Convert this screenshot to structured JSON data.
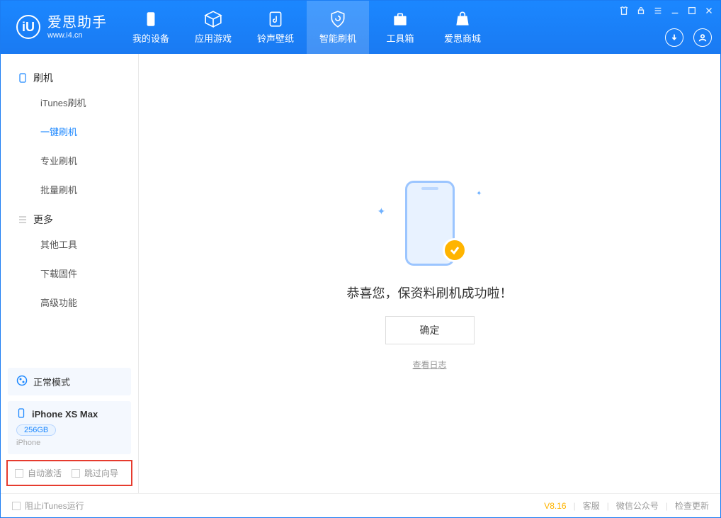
{
  "app": {
    "name": "爱思助手",
    "url": "www.i4.cn"
  },
  "tabs": [
    {
      "label": "我的设备"
    },
    {
      "label": "应用游戏"
    },
    {
      "label": "铃声壁纸"
    },
    {
      "label": "智能刷机"
    },
    {
      "label": "工具箱"
    },
    {
      "label": "爱思商城"
    }
  ],
  "sidebar": {
    "group_flash": "刷机",
    "items_flash": [
      {
        "label": "iTunes刷机"
      },
      {
        "label": "一键刷机"
      },
      {
        "label": "专业刷机"
      },
      {
        "label": "批量刷机"
      }
    ],
    "group_more": "更多",
    "items_more": [
      {
        "label": "其他工具"
      },
      {
        "label": "下载固件"
      },
      {
        "label": "高级功能"
      }
    ],
    "mode_card": {
      "label": "正常模式"
    },
    "device_card": {
      "name": "iPhone XS Max",
      "storage": "256GB",
      "type": "iPhone"
    },
    "options": {
      "auto_activate": "自动激活",
      "skip_guide": "跳过向导"
    }
  },
  "main": {
    "success_msg": "恭喜您，保资料刷机成功啦！",
    "ok_button": "确定",
    "view_log": "查看日志"
  },
  "footer": {
    "block_itunes": "阻止iTunes运行",
    "version": "V8.16",
    "links": [
      "客服",
      "微信公众号",
      "检查更新"
    ]
  }
}
